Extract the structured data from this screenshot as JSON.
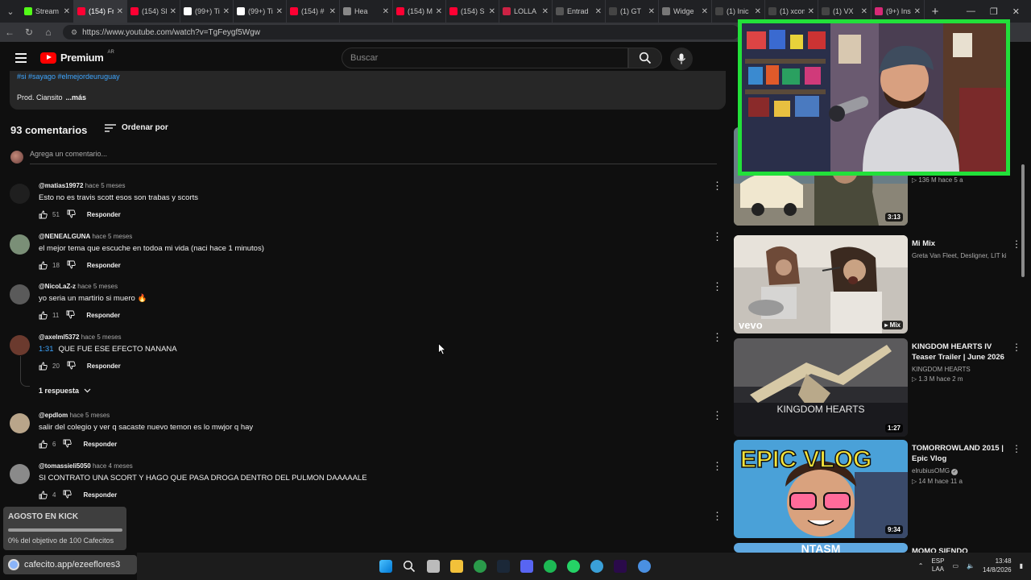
{
  "browser": {
    "tabs": [
      {
        "title": "Stream",
        "color": "#53fc18"
      },
      {
        "title": "(154) Fr",
        "color": "#ff0033",
        "active": true
      },
      {
        "title": "(154) Sl",
        "color": "#ff0033"
      },
      {
        "title": "(99+) Ti",
        "color": "#ffffff"
      },
      {
        "title": "(99+) Ti",
        "color": "#ffffff"
      },
      {
        "title": "(154) #",
        "color": "#ff0033"
      },
      {
        "title": "Hea",
        "color": "#888888"
      },
      {
        "title": "(154) M",
        "color": "#ff0033"
      },
      {
        "title": "(154) S",
        "color": "#ff0033"
      },
      {
        "title": "LOLLA",
        "color": "#cc2244"
      },
      {
        "title": "Entrad",
        "color": "#555555"
      },
      {
        "title": "(1) GT",
        "color": "#444444"
      },
      {
        "title": "Widge",
        "color": "#777777"
      },
      {
        "title": "(1) Inic",
        "color": "#444444"
      },
      {
        "title": "(1) xcom",
        "color": "#444444"
      },
      {
        "title": "(1) VX",
        "color": "#444444"
      },
      {
        "title": "(9+) Ins",
        "color": "#d62976"
      }
    ],
    "url": "https://www.youtube.com/watch?v=TgFeygf5Wgw"
  },
  "masthead": {
    "logo_text": "Premium",
    "country": "AR",
    "search_placeholder": "Buscar"
  },
  "description": {
    "tags": "#si #sayago #elmejordeuruguay",
    "credit": "Prod. Ciansito",
    "more": "...más"
  },
  "comments_section": {
    "count_label": "93 comentarios",
    "sort_label": "Ordenar por",
    "add_placeholder": "Agrega un comentario...",
    "reply_label": "Responder",
    "replies_toggle": "1 respuesta",
    "items": [
      {
        "user": "@matias19972",
        "time": "hace 5 meses",
        "text": "Esto no es travis scott esos son trabas y scorts",
        "likes": "51",
        "avatar_color": "#1f1f1f"
      },
      {
        "user": "@NENEALGUNA",
        "time": "hace 5 meses",
        "text": "el mejor tema que escuche en todoa mi vida (naci hace 1 minutos)",
        "likes": "18",
        "avatar_color": "#7a8f77"
      },
      {
        "user": "@NicoLaZ-z",
        "time": "hace 5 meses",
        "text": "yo seria un martirio si muero 🔥",
        "likes": "11",
        "avatar_color": "#5a5a5a"
      },
      {
        "user": "@axelml5372",
        "time": "hace 5 meses",
        "timestamp": "1:31",
        "text": "QUE FUE ESE EFECTO NANANA",
        "likes": "20",
        "avatar_color": "#6b3a2e"
      },
      {
        "user": "@epdlom",
        "time": "hace 5 meses",
        "text": "salir del colegio y ver q sacaste nuevo temon es lo mwjor q hay",
        "likes": "6",
        "avatar_color": "#b9a58a"
      },
      {
        "user": "@tomassieli5050",
        "time": "hace 4 meses",
        "text": "SI CONTRATO UNA SCORT Y HAGO QUE PASA DROGA DENTRO DEL PULMON DAAAAALE",
        "likes": "4",
        "avatar_color": "#8a8a8a"
      }
    ]
  },
  "overlays": {
    "kick_title": "AGOSTO EN KICK",
    "kick_goal": "0% del objetivo de 100 Cafecitos",
    "kick_progress": 0,
    "cafecito_label": "cafecito.app/ezeeflores3",
    "webcam_border_color": "#22e03a"
  },
  "sidebar": {
    "videos": [
      {
        "title": "",
        "channel": "",
        "stats": "▷ 136 M   hace 5 a",
        "duration": "3:13"
      },
      {
        "title": "Mi Mix",
        "channel": "Greta Van Fleet, Desligner, LIT kill...",
        "stats": "",
        "duration": "Mix",
        "thumb_text": "vevo"
      },
      {
        "title": "KINGDOM HEARTS IV Teaser Trailer | June 2026",
        "channel": "KINGDOM HEARTS",
        "stats": "▷ 1.3 M   hace 2 m",
        "duration": "1:27",
        "thumb_text": "KINGDOM HEARTS"
      },
      {
        "title": "TOMORROWLAND 2015 | Epic Vlog",
        "channel": "elrubiusOMG",
        "stats": "▷ 14 M   hace 11 a",
        "duration": "9:34",
        "thumb_text": "EPIC VLOG"
      },
      {
        "title": "MOMO SIENDO FANTASMA",
        "channel": "",
        "stats": "",
        "duration": "",
        "thumb_text": "NTASM"
      }
    ]
  },
  "taskbar": {
    "lang_1": "ESP",
    "lang_2": "LAA",
    "time": "13:48",
    "date": "14/8/2026"
  }
}
